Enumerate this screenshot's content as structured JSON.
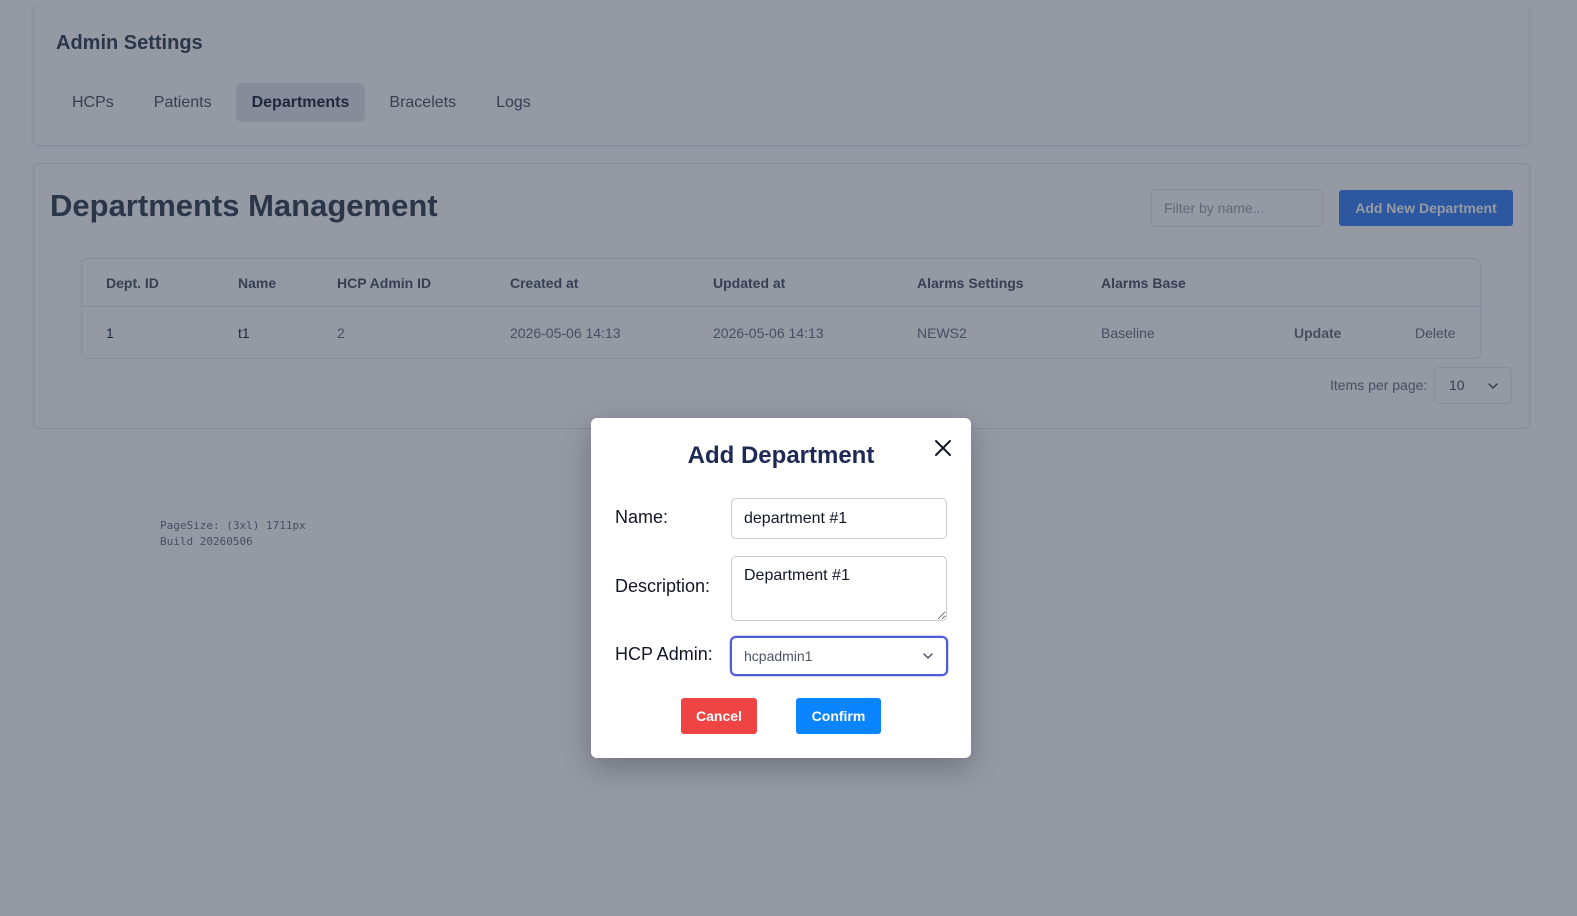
{
  "header": {
    "title": "Admin Settings",
    "tabs": [
      {
        "label": "HCPs"
      },
      {
        "label": "Patients"
      },
      {
        "label": "Departments"
      },
      {
        "label": "Bracelets"
      },
      {
        "label": "Logs"
      }
    ],
    "active_tab": "Departments"
  },
  "main": {
    "title": "Departments Management",
    "filter_placeholder": "Filter by name...",
    "add_button_label": "Add New Department",
    "table": {
      "columns": [
        "Dept. ID",
        "Name",
        "HCP Admin ID",
        "Created at",
        "Updated at",
        "Alarms Settings",
        "Alarms Base"
      ],
      "rows": [
        {
          "dept_id": "1",
          "name": "t1",
          "hcp_admin_id": "2",
          "created_at": "2026-05-06 14:13",
          "updated_at": "2026-05-06 14:13",
          "alarms_settings": "NEWS2",
          "alarms_base": "Baseline",
          "update_label": "Update",
          "delete_label": "Delete"
        }
      ]
    },
    "items_per_page_label": "Items per page:",
    "items_per_page_value": "10"
  },
  "build_info": {
    "page_size": "PageSize: (3xl) 1711px",
    "build": "Build 20260506"
  },
  "modal": {
    "title": "Add Department",
    "name_label": "Name:",
    "name_value": "department #1",
    "description_label": "Description:",
    "description_value": "Department #1",
    "hcp_admin_label": "HCP Admin:",
    "hcp_admin_value": "hcpadmin1",
    "cancel_label": "Cancel",
    "confirm_label": "Confirm"
  },
  "colors": {
    "primary": "#3b82f6",
    "confirm": "#0a84ff",
    "danger": "#ef4444",
    "modal_title": "#1e2a55",
    "focus_ring": "#4f5bd5"
  }
}
